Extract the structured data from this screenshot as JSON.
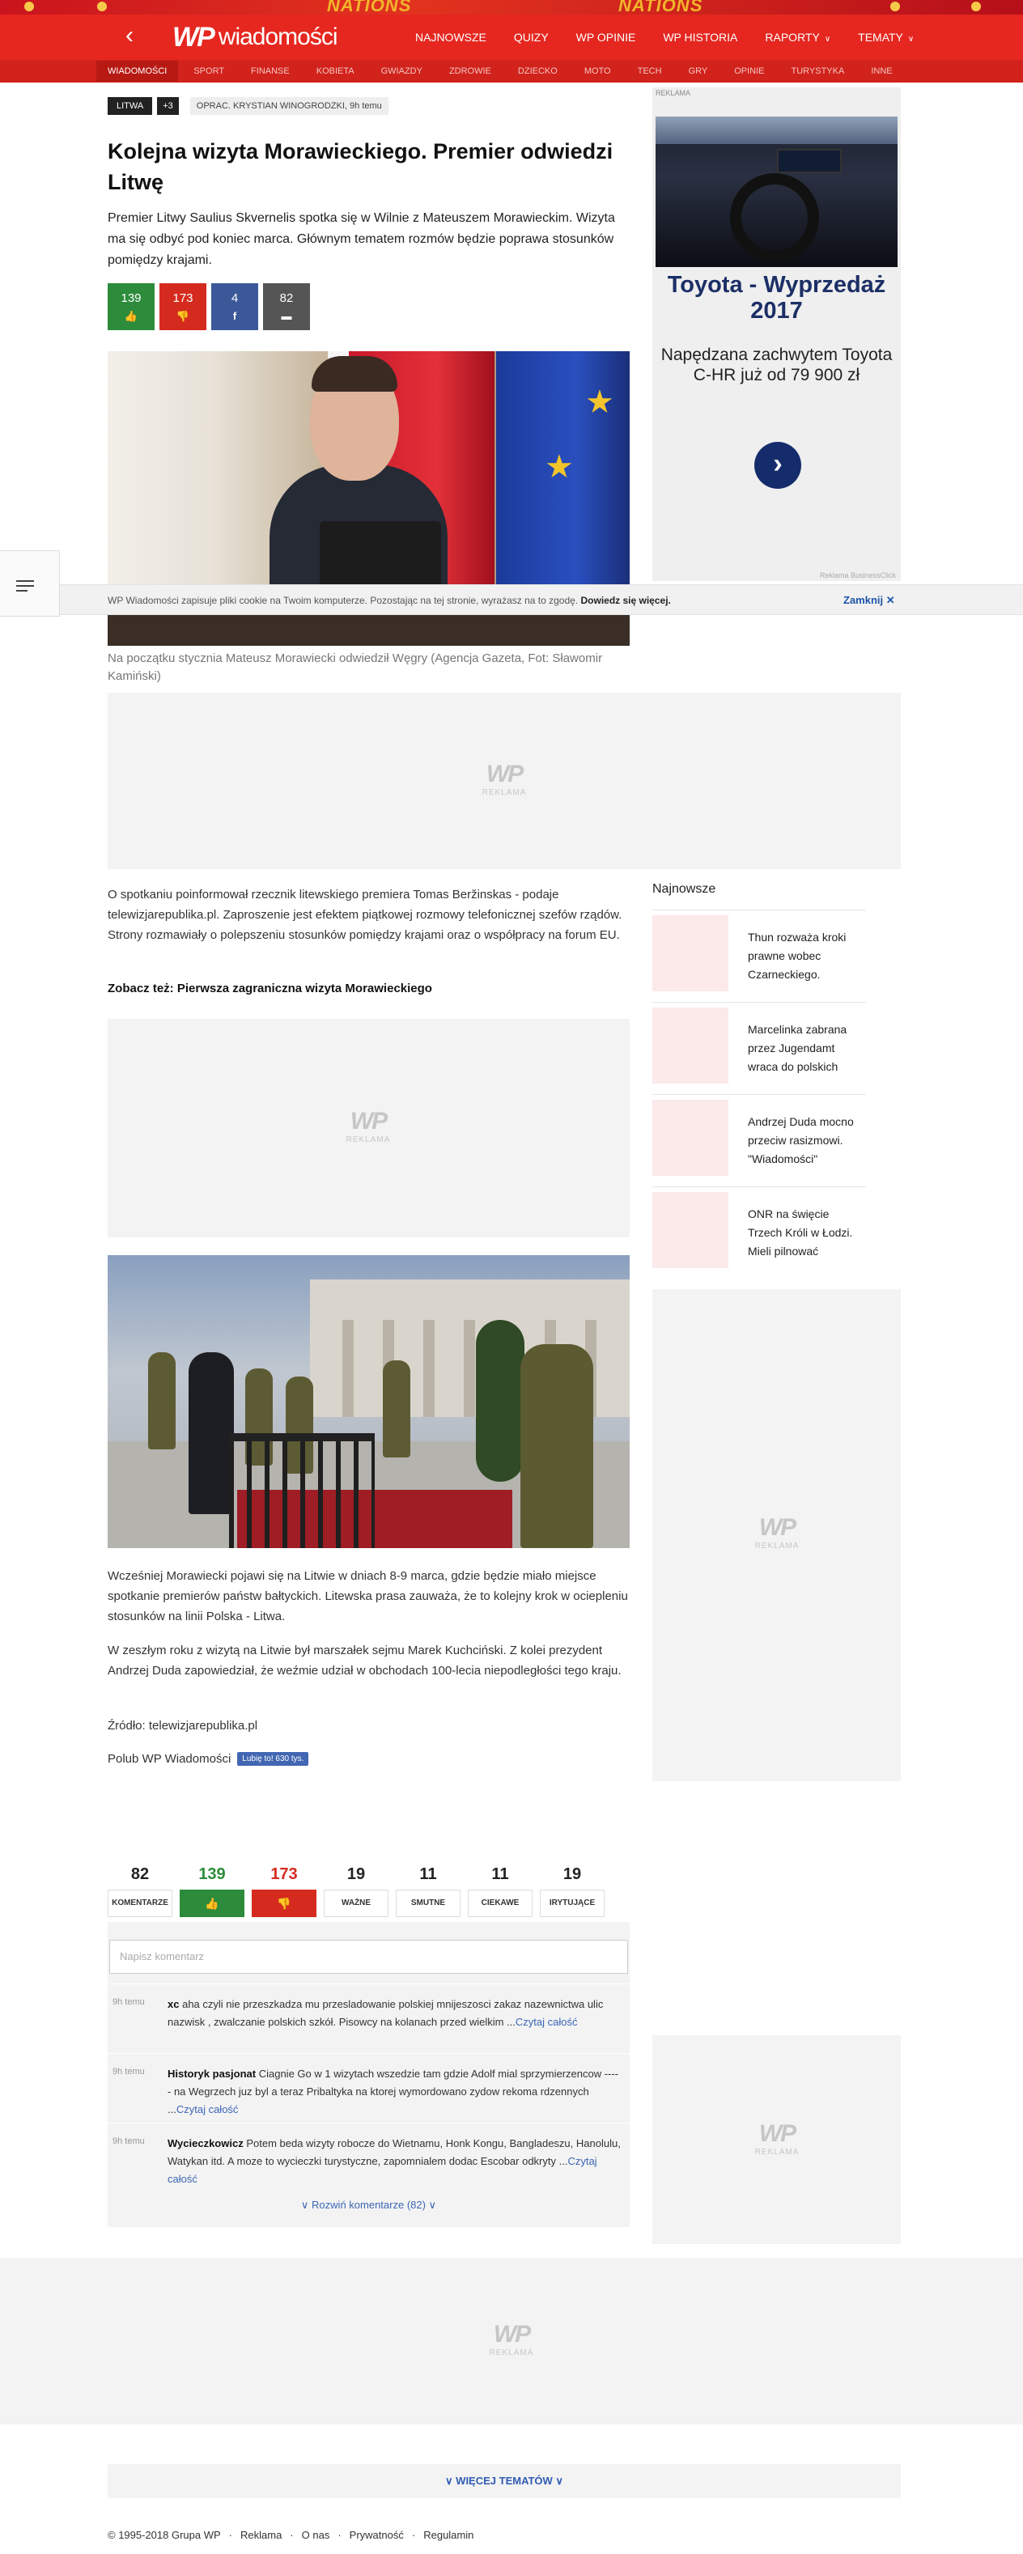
{
  "promo_strip": {
    "text": "NATIONS"
  },
  "header": {
    "logo_wp": "WP",
    "logo_name": "wiadomości",
    "nav": [
      {
        "label": "NAJNOWSZE"
      },
      {
        "label": "QUIZY"
      },
      {
        "label": "WP OPINIE"
      },
      {
        "label": "WP HISTORIA"
      },
      {
        "label": "RAPORTY"
      },
      {
        "label": "TEMATY"
      }
    ],
    "subnav": [
      "WIADOMOŚCI",
      "SPORT",
      "FINANSE",
      "KOBIETA",
      "GWIAZDY",
      "ZDROWIE",
      "DZIECKO",
      "MOTO",
      "TECH",
      "GRY",
      "OPINIE",
      "TURYSTYKA",
      "INNE"
    ]
  },
  "article": {
    "tag": "LITWA",
    "tag_more": "+3",
    "author": "OPRAC. KRYSTIAN WINOGRODZKI, 9h temu",
    "title": "Kolejna wizyta Morawieckiego. Premier odwiedzi Litwę",
    "lead": "Premier Litwy Saulius Skvernelis spotka się w Wilnie z Mateuszem Morawieckim. Wizyta ma się odbyć pod koniec marca. Głównym tematem rozmów będzie poprawa stosunków pomiędzy krajami.",
    "reactions": {
      "likes": "139",
      "dislikes": "173",
      "shares": "4",
      "comments": "82"
    },
    "photo1_caption": "Na początku stycznia Mateusz Morawiecki odwiedził Węgry (Agencja Gazeta, Fot: Sławomir Kamiński)",
    "para1": "O spotkaniu poinformował rzecznik litewskiego premiera Tomas Beržinskas - podaje telewizjarepublika.pl. Zaproszenie jest efektem piątkowej rozmowy telefonicznej szefów rządów. Strony rozmawiały o polepszeniu stosunków pomiędzy krajami oraz o współpracy na forum EU.",
    "see_also": "Zobacz też: Pierwsza zagraniczna wizyta Morawieckiego",
    "para2": "Wcześniej Morawiecki pojawi się na Litwie w dniach 8-9 marca, gdzie będzie miało miejsce spotkanie premierów państw bałtyckich. Litewska prasa zauważa, że to kolejny krok w ociepleniu stosunków na linii Polska - Litwa.",
    "para3": "W zeszłym roku z wizytą na Litwie był marszałek sejmu Marek Kuchciński. Z kolei prezydent Andrzej Duda zapowiedział, że weźmie udział w obchodach 100-lecia niepodległości tego kraju.",
    "source": "Źródło: telewizjarepublika.pl",
    "like_text": "Polub WP Wiadomości",
    "like_btn": "Lubię to! 630 tys."
  },
  "cookie": {
    "text": "WP Wiadomości zapisuje pliki cookie na Twoim komputerze. Pozostając na tej stronie, wyrażasz na to zgodę.",
    "link": "Dowiedz się więcej.",
    "close": "Zamknij"
  },
  "ads": {
    "label": "REKLAMA",
    "wp": "WP",
    "reklama": "REKLAMA",
    "toyota_title": "Toyota - Wyprzedaż 2017",
    "toyota_body": "Napędzana zachwytem Toyota C-HR już od 79 900 zł",
    "toyota_source": "Reklama BusinessClick"
  },
  "sidebar": {
    "heading": "Najnowsze",
    "items": [
      {
        "title": "Thun rozważa kroki prawne wobec Czarneckiego."
      },
      {
        "title": "Marcelinka zabrana przez Jugendamt wraca do polskich"
      },
      {
        "title": "Andrzej Duda mocno przeciw rasizmowi. \"Wiadomości\""
      },
      {
        "title": "ONR na święcie Trzech Króli w Łodzi. Mieli pilnować"
      }
    ]
  },
  "comments": {
    "counts": [
      {
        "num": "82",
        "label": "KOMENTARZE"
      },
      {
        "num": "139",
        "label": "👍"
      },
      {
        "num": "173",
        "label": "👎"
      },
      {
        "num": "19",
        "label": "WAŻNE"
      },
      {
        "num": "11",
        "label": "SMUTNE"
      },
      {
        "num": "11",
        "label": "CIEKAWE"
      },
      {
        "num": "19",
        "label": "IRYTUJĄCE"
      }
    ],
    "placeholder": "Napisz komentarz",
    "items": [
      {
        "time": "9h temu",
        "author": "xc",
        "text": "aha czyli nie przeszkadza mu przesladowanie polskiej mnijeszosci zakaz nazewnictwa ulic nazwisk , zwalczanie polskich szkół. Pisowcy na kolanach przed wielkim ...",
        "more": "Czytaj całość"
      },
      {
        "time": "9h temu",
        "author": "Historyk pasjonat",
        "text": "Ciagnie Go w 1 wizytach wszedzie tam gdzie Adolf mial sprzymierzencow ----- na Wegrzech juz byl a teraz Pribaltyka na ktorej wymordowano zydow rekoma rdzennych ...",
        "more": "Czytaj całość"
      },
      {
        "time": "9h temu",
        "author": "Wycieczkowicz",
        "text": "Potem beda wizyty robocze do Wietnamu, Honk Kongu, Bangladeszu, Hanolulu, Watykan itd. A moze to wycieczki turystyczne, zapomnialem dodac Escobar odkryty ...",
        "more": "Czytaj całość"
      }
    ],
    "expand": "Rozwiń komentarze (82)"
  },
  "footer": {
    "more_topics": "WIĘCEJ TEMATÓW",
    "links": [
      "© 1995-2018 Grupa WP",
      "Reklama",
      "O nas",
      "Prywatność",
      "Regulamin"
    ]
  }
}
